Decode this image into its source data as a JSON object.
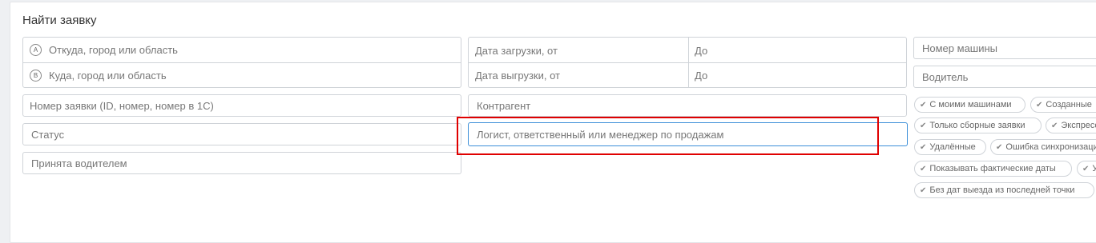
{
  "title": "Найти заявку",
  "route": {
    "from_letter": "A",
    "from_placeholder": "Откуда, город или область",
    "to_letter": "B",
    "to_placeholder": "Куда, город или область"
  },
  "dates": {
    "load_from": "Дата загрузки, от",
    "load_to": "До",
    "unload_from": "Дата выгрузки, от",
    "unload_to": "До"
  },
  "fields": {
    "order_number": "Номер заявки (ID, номер, номер в 1С)",
    "status": "Статус",
    "accepted_by_driver": "Принята водителем",
    "counterparty": "Контрагент",
    "logist": "Логист, ответственный или менеджер по продажам",
    "car_number": "Номер машины",
    "driver": "Водитель"
  },
  "chips": [
    "С моими машинами",
    "Созданные",
    "Только сборные заявки",
    "Экспресс",
    "Удалённые",
    "Ошибка синхронизации",
    "Показывать фактические даты",
    "У",
    "Без дат выезда из последней точки"
  ],
  "icons": {
    "chip_check": "check-icon"
  },
  "colors": {
    "focus_border": "#3d8fd8",
    "annotation_box": "#e00000"
  }
}
